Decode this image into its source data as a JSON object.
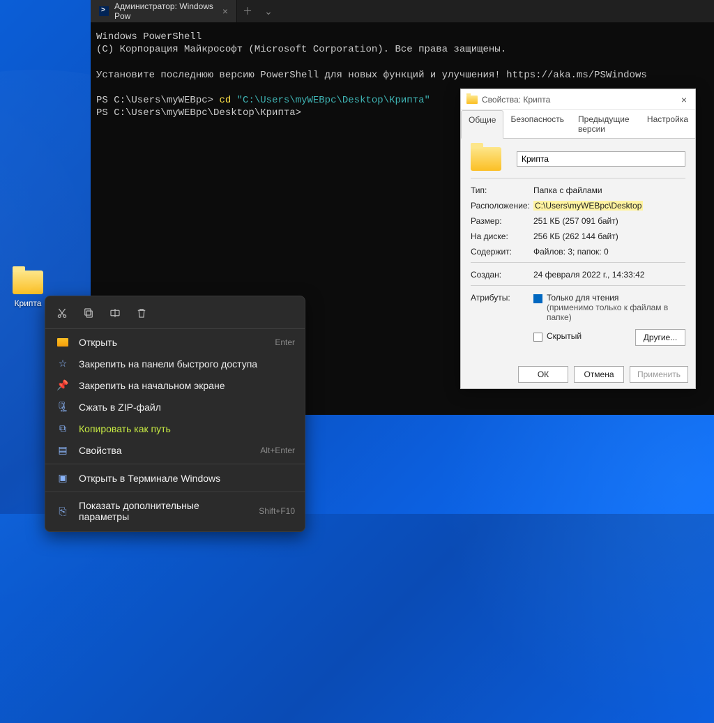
{
  "desktop": {
    "folder_label": "Крипта"
  },
  "terminal": {
    "tab_title": "Администратор: Windows Pow",
    "line1": "Windows PowerShell",
    "line2": "(C) Корпорация Майкрософт (Microsoft Corporation). Все права защищены.",
    "line3a": "Установите последнюю версию PowerShell для новых функций и улучшения! ",
    "line3b": "https://aka.ms/PSWindows",
    "prompt1_prefix": "PS C:\\Users\\myWEBpc> ",
    "prompt1_cmd": "cd",
    "prompt1_arg": "\"C:\\Users\\myWEBpc\\Desktop\\Крипта\"",
    "prompt2": "PS C:\\Users\\myWEBpc\\Desktop\\Крипта>"
  },
  "ctx": {
    "open": "Открыть",
    "open_sc": "Enter",
    "pin_quick": "Закрепить на панели быстрого доступа",
    "pin_start": "Закрепить на начальном экране",
    "zip": "Сжать в ZIP-файл",
    "copy_path": "Копировать как путь",
    "props": "Свойства",
    "props_sc": "Alt+Enter",
    "open_terminal": "Открыть в Терминале Windows",
    "more": "Показать дополнительные параметры",
    "more_sc": "Shift+F10"
  },
  "props": {
    "title": "Свойства: Крипта",
    "tabs": {
      "general": "Общие",
      "security": "Безопасность",
      "prev": "Предыдущие версии",
      "custom": "Настройка"
    },
    "name": "Крипта",
    "type_l": "Тип:",
    "type_v": "Папка с файлами",
    "loc_l": "Расположение:",
    "loc_v": "C:\\Users\\myWEBpc\\Desktop",
    "size_l": "Размер:",
    "size_v": "251 КБ (257 091 байт)",
    "disk_l": "На диске:",
    "disk_v": "256 КБ (262 144 байт)",
    "contains_l": "Содержит:",
    "contains_v": "Файлов: 3; папок: 0",
    "created_l": "Создан:",
    "created_v": "24 февраля 2022 г., 14:33:42",
    "attrs_l": "Атрибуты:",
    "readonly": "Только для чтения",
    "readonly_sub": "(применимо только к файлам в папке)",
    "hidden": "Скрытый",
    "other": "Другие...",
    "ok": "ОК",
    "cancel": "Отмена",
    "apply": "Применить"
  }
}
